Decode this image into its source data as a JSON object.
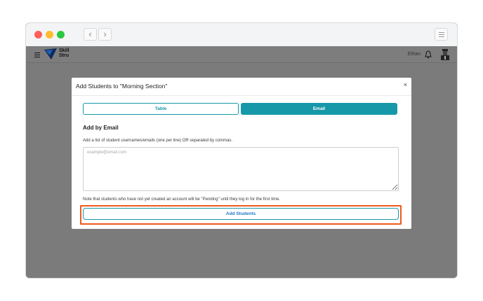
{
  "window": {
    "controls": [
      "close",
      "minimize",
      "zoom"
    ],
    "nav": {
      "back_icon": "chevron-left-icon",
      "forward_icon": "chevron-right-icon",
      "back_glyph": "‹",
      "forward_glyph": "›"
    },
    "menu_icon": "menu-lines-icon"
  },
  "appbar": {
    "menu_icon": "hamburger-icon",
    "logo_icon": "skill-struck-logo-icon",
    "logo_text_line1": "Skill",
    "logo_text_line2": "Stru",
    "user_name": "Ethan",
    "bell_icon": "bell-icon",
    "avatar_icon": "avatar-icon"
  },
  "modal": {
    "title": "Add Students to \"Morning Section\"",
    "close_glyph": "×",
    "tabs": [
      {
        "label": "Table",
        "active": false
      },
      {
        "label": "Email",
        "active": true
      }
    ],
    "section_title": "Add by Email",
    "instruction": "Add a list of student usernames/emails (one per line) OR separated by commas.",
    "textarea": {
      "placeholder": "example@email.com",
      "value": ""
    },
    "note": "Note that students who have not yet created an account will be \"Pending\" until they log in for the first time.",
    "submit_label": "Add Students"
  },
  "widgets": {
    "chat_icon": "chat-bubble-icon",
    "dots_icon": "grid-dots-icon"
  },
  "colors": {
    "accent": "#1798a8",
    "highlight": "#f0591e",
    "button_text": "#2079c7",
    "chat": "#1a73e8"
  }
}
